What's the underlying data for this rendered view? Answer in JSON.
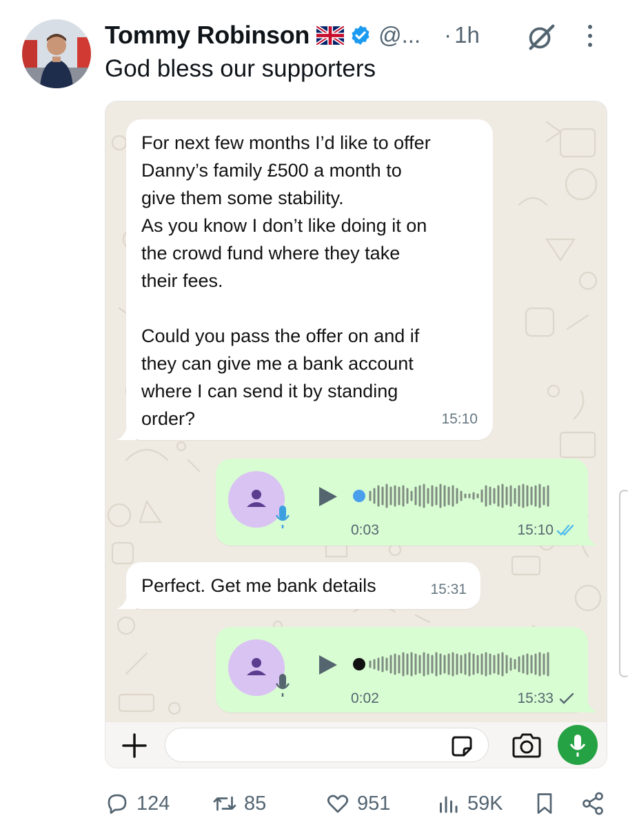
{
  "post": {
    "author_name": "Tommy Robinson",
    "handle": "@...",
    "separator": "·",
    "time": "1h",
    "text": "God bless our supporters"
  },
  "chat": {
    "messages": [
      {
        "type": "text",
        "direction": "incoming",
        "text": "For next few months I’d like to offer\nDanny’s family £500 a month to\ngive them some stability.\nAs you know I don’t like doing it on\nthe crowd fund where they take\ntheir fees.\n\nCould you pass the offer on and if\nthey can give me a bank account\nwhere I can send it by standing\norder?",
        "time": "15:10"
      },
      {
        "type": "voice",
        "direction": "outgoing",
        "duration": "0:03",
        "time": "15:10",
        "status": "read-double-tick"
      },
      {
        "type": "text",
        "direction": "incoming",
        "text": "Perfect. Get me bank details",
        "time": "15:31"
      },
      {
        "type": "voice",
        "direction": "outgoing",
        "duration": "0:02",
        "time": "15:33",
        "status": "sent-single-tick"
      }
    ],
    "input": {
      "value": "",
      "placeholder": ""
    }
  },
  "actions": {
    "replies": "124",
    "reposts": "85",
    "likes": "951",
    "views": "59K"
  },
  "colors": {
    "verified": "#1d9bf0",
    "incoming_bubble": "#ffffff",
    "outgoing_bubble": "#d9fdd3",
    "chat_wallpaper": "#efeae2",
    "send_button": "#25a244",
    "read_tick": "#53bdeb",
    "muted_text": "#536471"
  },
  "icons": [
    "union-jack-flag-icon",
    "verified-badge-icon",
    "grok-icon",
    "more-icon",
    "reply-icon",
    "repost-icon",
    "like-icon",
    "views-icon",
    "bookmark-icon",
    "share-icon",
    "plus-icon",
    "sticker-icon",
    "camera-icon",
    "mic-icon",
    "play-icon"
  ]
}
